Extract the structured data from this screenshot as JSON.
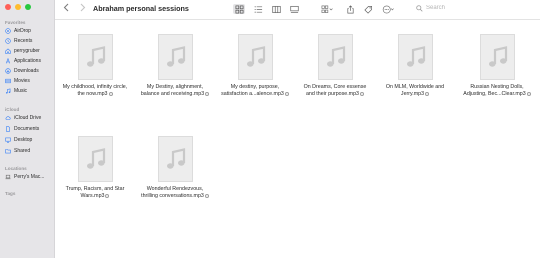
{
  "window": {
    "title": "Abraham personal sessions"
  },
  "colors": {
    "close": "#ff5f57",
    "minimize": "#febc2e",
    "zoom": "#28c840",
    "accent": "#3b82f6"
  },
  "sidebar": {
    "favorites_header": "Favorites",
    "favorites": [
      {
        "label": "AirDrop",
        "icon": "airdrop-icon"
      },
      {
        "label": "Recents",
        "icon": "clock-icon"
      },
      {
        "label": "perrygruber",
        "icon": "home-icon"
      },
      {
        "label": "Applications",
        "icon": "applications-icon"
      },
      {
        "label": "Downloads",
        "icon": "download-icon"
      },
      {
        "label": "Movies",
        "icon": "film-icon"
      },
      {
        "label": "Music",
        "icon": "music-icon"
      }
    ],
    "icloud_header": "iCloud",
    "icloud": [
      {
        "label": "iCloud Drive",
        "icon": "cloud-icon"
      },
      {
        "label": "Documents",
        "icon": "document-icon"
      },
      {
        "label": "Desktop",
        "icon": "desktop-icon"
      },
      {
        "label": "Shared",
        "icon": "shared-folder-icon"
      }
    ],
    "locations_header": "Locations",
    "locations": [
      {
        "label": "Perry's Mac...",
        "icon": "laptop-icon"
      }
    ],
    "tags_header": "Tags"
  },
  "toolbar": {
    "back_icon": "chevron-left-icon",
    "forward_icon": "chevron-right-icon",
    "search": {
      "value": "",
      "placeholder": "Search"
    }
  },
  "files": [
    {
      "name": "My childhood, infinity circle, the now.mp3",
      "line1": "My childhood, infinity circle,",
      "line2": "the now.mp3"
    },
    {
      "name": "My Destiny, alighnment, balance and receiving.mp3",
      "line1": "My Destiny, alighnment,",
      "line2": "balance and receiving.mp3"
    },
    {
      "name": "My destiny, purpose, satisfaction a...alence.mp3",
      "line1": "My destiny, purpose,",
      "line2": "satisfaction a...alence.mp3"
    },
    {
      "name": "On Dreams, Core essense and their purpose.mp3",
      "line1": "On Dreams, Core essense",
      "line2": "and their purpose.mp3"
    },
    {
      "name": "On MLM, Worldwide and Jerry.mp3",
      "line1": "On MLM, Worldwide and",
      "line2": "Jerry.mp3"
    },
    {
      "name": "Russian Nesting Dolls, Adjusting, Bec...Clear.mp3",
      "line1": "Russian Nesting Dolls,",
      "line2": "Adjusting, Bec...Clear.mp3"
    },
    {
      "name": "Trump, Racism, and Star Wars.mp3",
      "line1": "Trump, Racism, and Star",
      "line2": "Wars.mp3"
    },
    {
      "name": "Wonderful Rendezvous, thrilling conversations.mp3",
      "line1": "Wonderful Rendezvous,",
      "line2": "thrilling conversations.mp3"
    }
  ]
}
